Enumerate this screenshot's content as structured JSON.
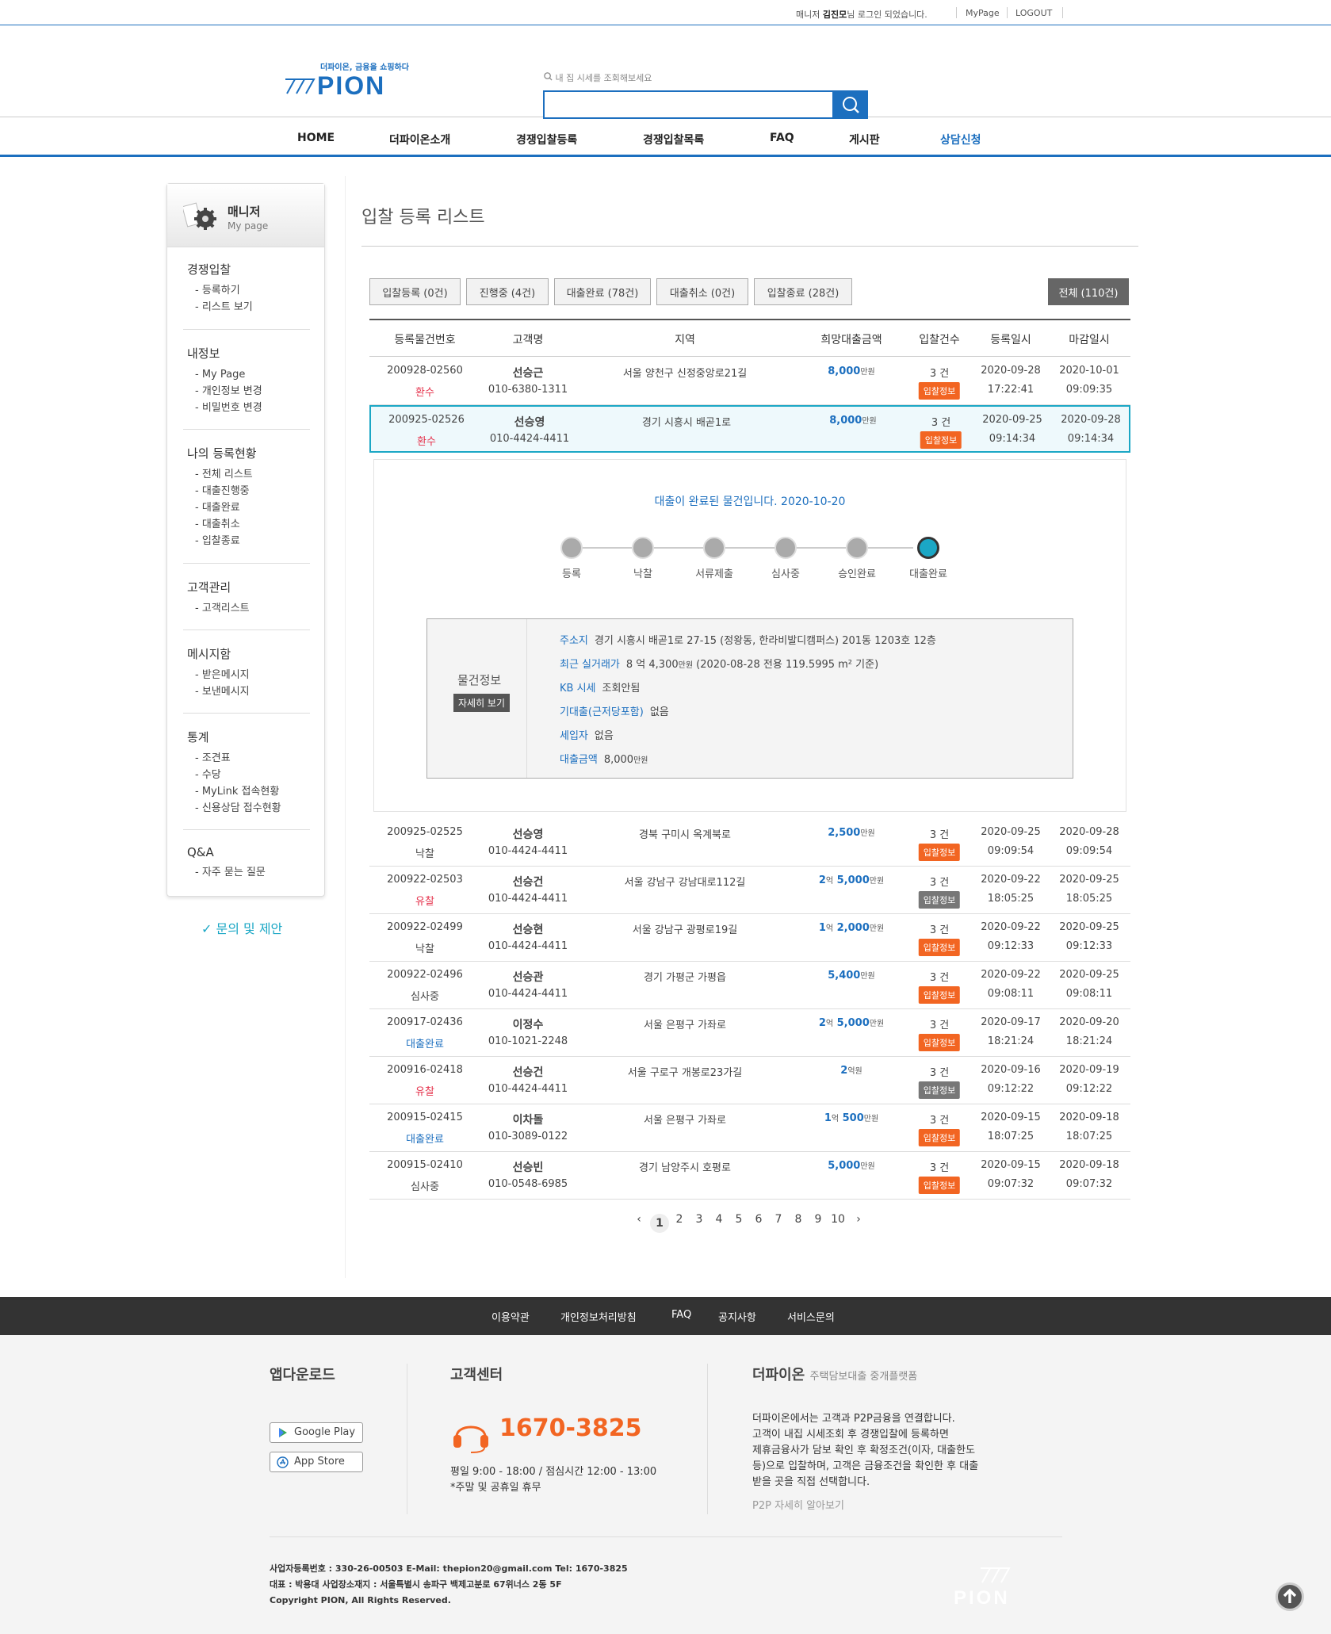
{
  "topbar": {
    "login_pre": "매니저 ",
    "login_name": "김진모",
    "login_post": "님 로그인 되었습니다.",
    "mypage": "MyPage",
    "logout": "LOGOUT"
  },
  "header": {
    "logo_tagline": "더파이온, 금융을 쇼핑하다",
    "logo_word": "PION",
    "search_placeholder": "내 집 시세를 조회해보세요"
  },
  "nav": [
    "HOME",
    "더파이온소개",
    "경쟁입찰등록",
    "경쟁입찰목록",
    "FAQ",
    "게시판",
    "상담신청"
  ],
  "sidebar": {
    "head_title": "매니저",
    "head_sub": "My page",
    "sections": [
      {
        "title": "경쟁입찰",
        "items": [
          "- 등록하기",
          "- 리스트 보기"
        ]
      },
      {
        "title": "내정보",
        "items": [
          "- My Page",
          "- 개인정보 변경",
          "- 비밀번호 변경"
        ]
      },
      {
        "title": "나의 등록현황",
        "items": [
          "- 전체 리스트",
          "- 대출진행중",
          "- 대출완료",
          "- 대출취소",
          "- 입찰종료"
        ]
      },
      {
        "title": "고객관리",
        "items": [
          "- 고객리스트"
        ]
      },
      {
        "title": "메시지함",
        "items": [
          "- 받은메시지",
          "- 보낸메시지"
        ]
      },
      {
        "title": "통계",
        "items": [
          "- 조견표",
          "- 수당",
          "- MyLink 접속현황",
          "- 신용상담 접수현황"
        ]
      },
      {
        "title": "Q&A",
        "items": [
          "- 자주 묻는 질문"
        ]
      }
    ],
    "inquiry": "✓ 문의 및 제안"
  },
  "main": {
    "title": "입찰 등록 리스트",
    "filters": [
      "입찰등록 (0건)",
      "진행중 (4건)",
      "대출완료 (78건)",
      "대출취소 (0건)",
      "입찰종료 (28건)"
    ],
    "filter_all": "전체 (110건)",
    "columns": [
      "등록물건번호",
      "고객명",
      "지역",
      "희망대출금액",
      "입찰건수",
      "등록일시",
      "마감일시"
    ],
    "rows": [
      {
        "id": "200928-02560",
        "status": "환수",
        "status_color": "#e5314b",
        "name": "선승근",
        "phone": "010-6380-1311",
        "region": "서울 양천구 신정중앙로21길",
        "amt_main": "8,000",
        "amt_unit": "만원",
        "amt_pre": "",
        "amt_pre_unit": "",
        "bids": "3 건",
        "badge": "입찰정보",
        "badge_color": "#f26522",
        "reg_date": "2020-09-28",
        "reg_time": "17:22:41",
        "end_date": "2020-10-01",
        "end_time": "09:09:35"
      },
      {
        "id": "200925-02526",
        "status": "환수",
        "status_color": "#e5314b",
        "name": "선승영",
        "phone": "010-4424-4411",
        "region": "경기 시흥시 배곧1로",
        "amt_main": "8,000",
        "amt_unit": "만원",
        "amt_pre": "",
        "amt_pre_unit": "",
        "bids": "3 건",
        "badge": "입찰정보",
        "badge_color": "#f26522",
        "reg_date": "2020-09-25",
        "reg_time": "09:14:34",
        "end_date": "2020-09-28",
        "end_time": "09:14:34"
      },
      {
        "id": "200925-02525",
        "status": "낙찰",
        "status_color": "#444444",
        "name": "선승영",
        "phone": "010-4424-4411",
        "region": "경북 구미시 옥계북로",
        "amt_main": "2,500",
        "amt_unit": "만원",
        "amt_pre": "",
        "amt_pre_unit": "",
        "bids": "3 건",
        "badge": "입찰정보",
        "badge_color": "#f26522",
        "reg_date": "2020-09-25",
        "reg_time": "09:09:54",
        "end_date": "2020-09-28",
        "end_time": "09:09:54"
      },
      {
        "id": "200922-02503",
        "status": "유찰",
        "status_color": "#e5314b",
        "name": "선승건",
        "phone": "010-4424-4411",
        "region": "서울 강남구 강남대로112길",
        "amt_main": "5,000",
        "amt_unit": "만원",
        "amt_pre": "2",
        "amt_pre_unit": "억",
        "bids": "3 건",
        "badge": "입찰정보",
        "badge_color": "#777777",
        "reg_date": "2020-09-22",
        "reg_time": "18:05:25",
        "end_date": "2020-09-25",
        "end_time": "18:05:25"
      },
      {
        "id": "200922-02499",
        "status": "낙찰",
        "status_color": "#444444",
        "name": "선승현",
        "phone": "010-4424-4411",
        "region": "서울 강남구 광평로19길",
        "amt_main": "2,000",
        "amt_unit": "만원",
        "amt_pre": "1",
        "amt_pre_unit": "억",
        "bids": "3 건",
        "badge": "입찰정보",
        "badge_color": "#f26522",
        "reg_date": "2020-09-22",
        "reg_time": "09:12:33",
        "end_date": "2020-09-25",
        "end_time": "09:12:33"
      },
      {
        "id": "200922-02496",
        "status": "심사중",
        "status_color": "#444444",
        "name": "선승관",
        "phone": "010-4424-4411",
        "region": "경기 가평군 가평읍",
        "amt_main": "5,400",
        "amt_unit": "만원",
        "amt_pre": "",
        "amt_pre_unit": "",
        "bids": "3 건",
        "badge": "입찰정보",
        "badge_color": "#f26522",
        "reg_date": "2020-09-22",
        "reg_time": "09:08:11",
        "end_date": "2020-09-25",
        "end_time": "09:08:11"
      },
      {
        "id": "200917-02436",
        "status": "대출완료",
        "status_color": "#1c6fbf",
        "name": "이정수",
        "phone": "010-1021-2248",
        "region": "서울 은평구 가좌로",
        "amt_main": "5,000",
        "amt_unit": "만원",
        "amt_pre": "2",
        "amt_pre_unit": "억",
        "bids": "3 건",
        "badge": "입찰정보",
        "badge_color": "#f26522",
        "reg_date": "2020-09-17",
        "reg_time": "18:21:24",
        "end_date": "2020-09-20",
        "end_time": "18:21:24"
      },
      {
        "id": "200916-02418",
        "status": "유찰",
        "status_color": "#e5314b",
        "name": "선승건",
        "phone": "010-4424-4411",
        "region": "서울 구로구 개봉로23가길",
        "amt_main": "",
        "amt_unit": "",
        "amt_pre": "2",
        "amt_pre_unit": "억원",
        "bids": "3 건",
        "badge": "입찰정보",
        "badge_color": "#777777",
        "reg_date": "2020-09-16",
        "reg_time": "09:12:22",
        "end_date": "2020-09-19",
        "end_time": "09:12:22"
      },
      {
        "id": "200915-02415",
        "status": "대출완료",
        "status_color": "#1c6fbf",
        "name": "이차돌",
        "phone": "010-3089-0122",
        "region": "서울 은평구 가좌로",
        "amt_main": "500",
        "amt_unit": "만원",
        "amt_pre": "1",
        "amt_pre_unit": "억",
        "bids": "3 건",
        "badge": "입찰정보",
        "badge_color": "#f26522",
        "reg_date": "2020-09-15",
        "reg_time": "18:07:25",
        "end_date": "2020-09-18",
        "end_time": "18:07:25"
      },
      {
        "id": "200915-02410",
        "status": "심사중",
        "status_color": "#444444",
        "name": "선승빈",
        "phone": "010-0548-6985",
        "region": "경기 남양주시 호평로",
        "amt_main": "5,000",
        "amt_unit": "만원",
        "amt_pre": "",
        "amt_pre_unit": "",
        "bids": "3 건",
        "badge": "입찰정보",
        "badge_color": "#f26522",
        "reg_date": "2020-09-15",
        "reg_time": "09:07:32",
        "end_date": "2020-09-18",
        "end_time": "09:07:32"
      }
    ],
    "detail": {
      "message": "대출이 완료된 물건입니다. 2020-10-20",
      "steps": [
        "등록",
        "낙찰",
        "서류제출",
        "심사중",
        "승인완료",
        "대출완료"
      ],
      "box_title": "물건정보",
      "box_btn": "자세히 보기",
      "address_k": "주소지",
      "address_v": "경기 시흥시 배곧1로 27-15 (정왕동, 한라비발디캠퍼스) 201동 1203호 12층",
      "price_k": "최근 실거래가",
      "price_v1": "8 억 4,300",
      "price_unit": "만원",
      "price_v2": "(2020-08-28 전용 119.5995 m² 기준)",
      "kb_k": "KB 시세",
      "kb_v": "조회안됨",
      "loan_k": "기대출(근저당포함)",
      "loan_v": "없음",
      "tenant_k": "세입자",
      "tenant_v": "없음",
      "amount_k": "대출금액",
      "amount_v": "8,000",
      "amount_unit": "만원"
    },
    "pages": [
      "1",
      "2",
      "3",
      "4",
      "5",
      "6",
      "7",
      "8",
      "9",
      "10"
    ],
    "prev": "‹",
    "next": "›"
  },
  "footer": {
    "nav": [
      "이용약관",
      "개인정보처리방침",
      "FAQ",
      "공지사항",
      "서비스문의"
    ],
    "app_title": "앱다운로드",
    "google_play": "Google Play",
    "app_store": "App Store",
    "cs_title": "고객센터",
    "phone": "1670-3825",
    "hours": "평일 9:00 - 18:00 / 점심시간 12:00 - 13:00",
    "holiday": "*주말 및 공휴일 휴무",
    "about_title": "더파이온",
    "about_sub": "주택담보대출 중개플랫폼",
    "about_lines": [
      "더파이온에서는 고객과 P2P금융을 연결합니다.",
      "고객이 내집 시세조회 후 경쟁입찰에 등록하면",
      "제휴금융사가 담보 확인 후 확정조건(이자, 대출한도",
      "등)으로 입찰하며, 고객은 금융조건을 확인한 후 대출",
      "받을 곳을 직접 선택합니다."
    ],
    "about_link": "P2P 자세히 알아보기",
    "biz": "사업자등록번호 : 330-26-00503 E-Mail: thepion20@gmail.com Tel: 1670-3825",
    "ceo": "대표 : 박용대 사업장소재지 : 서울특별시 송파구 백제고분로 67위너스 2동 5F",
    "copy": "Copyright PION, All Rights Reserved.",
    "logo_word": "PION"
  }
}
